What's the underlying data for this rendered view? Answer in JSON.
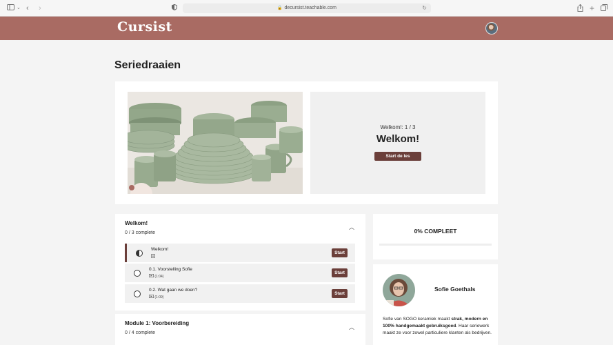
{
  "browser": {
    "url": "decursist.teachable.com"
  },
  "header": {
    "logo": "Cursist"
  },
  "page": {
    "title": "Seriedraaien"
  },
  "hero": {
    "subtitle": "Welkom!: 1 / 3",
    "title": "Welkom!",
    "button_label": "Start de les"
  },
  "modules": [
    {
      "title": "Welkom!",
      "progress": "0 / 3 complete",
      "lessons": [
        {
          "name": "Welkom!",
          "meta": "",
          "button": "Start",
          "status": "in-progress"
        },
        {
          "name": "0.1. Voorstelling Sofie",
          "meta": "(1:04)",
          "button": "Start",
          "status": "not-started"
        },
        {
          "name": "0.2. Wat gaan we doen?",
          "meta": "(1:09)",
          "button": "Start",
          "status": "not-started"
        }
      ]
    },
    {
      "title": "Module 1: Voorbereiding",
      "progress": "0 / 4 complete"
    }
  ],
  "progress": {
    "label": "0% COMPLEET",
    "percent": 0
  },
  "author": {
    "name": "Sofie Goethals",
    "bio_intro": "Sofie van SOGO keramiek maakt ",
    "bio_bold": "strak, modern en 100% handgemaakt gebruiksgoed",
    "bio_rest": ". Haar seriewerk maakt ze voor zowel particuliere klanten als bedrijven."
  },
  "colors": {
    "brand": "#a96b63",
    "button": "#6b3f3a"
  }
}
